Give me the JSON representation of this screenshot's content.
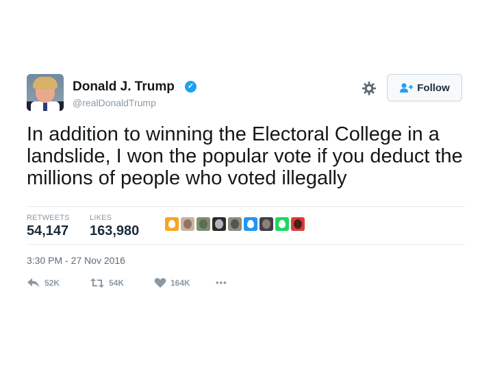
{
  "author": {
    "name": "Donald J. Trump",
    "handle": "@realDonaldTrump",
    "verified_glyph": "✓"
  },
  "follow_button": {
    "label": "Follow",
    "icon": "add-user-icon"
  },
  "settings_icon": "gear-icon",
  "tweet_text": "In addition to winning the Electoral College in a landslide, I won the popular vote if you deduct the millions of people who voted illegally",
  "stats": {
    "retweets_label": "RETWEETS",
    "retweets_value": "54,147",
    "likes_label": "LIKES",
    "likes_value": "163,980"
  },
  "likers": [
    {
      "type": "egg",
      "color": "#f5a623"
    },
    {
      "type": "photo",
      "color": "#c9b3a0",
      "accent": "#7a5a48"
    },
    {
      "type": "photo",
      "color": "#7f8f72",
      "accent": "#4f5e44"
    },
    {
      "type": "photo",
      "color": "#2a2a2a",
      "accent": "#f0f0f0"
    },
    {
      "type": "photo",
      "color": "#8c8c80",
      "accent": "#3d3d38"
    },
    {
      "type": "egg",
      "color": "#2196f3"
    },
    {
      "type": "photo",
      "color": "#3b3f4a",
      "accent": "#b89a80"
    },
    {
      "type": "egg",
      "color": "#1ed760"
    },
    {
      "type": "photo",
      "color": "#d93b3b",
      "accent": "#111111"
    }
  ],
  "timestamp": "3:30 PM - 27 Nov 2016",
  "actions": {
    "reply_count": "52K",
    "retweet_count": "54K",
    "like_count": "164K",
    "more_label": "•••"
  },
  "colors": {
    "verified": "#1da1f2",
    "muted": "#8b98a4",
    "text": "#14171a"
  }
}
